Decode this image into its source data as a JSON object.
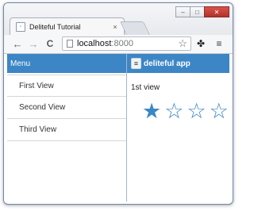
{
  "browser": {
    "tab_title": "Deliteful Tutorial",
    "tab_close": "×",
    "window_controls": {
      "minimize": "–",
      "maximize": "□",
      "close": "✕"
    },
    "nav": {
      "back": "←",
      "forward": "→",
      "reload": "C"
    },
    "url_host": "localhost",
    "url_port": ":8000",
    "bookmark_star": "☆",
    "extension_icon": "puzzle-icon",
    "menu_icon": "≡"
  },
  "menu": {
    "title": "Menu",
    "items": [
      {
        "label": "First View"
      },
      {
        "label": "Second View"
      },
      {
        "label": "Third View"
      }
    ]
  },
  "app": {
    "title": "deliteful app",
    "toggle_label": "≡",
    "view_label": "1st view",
    "rating": {
      "value": 1,
      "max": 4
    }
  },
  "colors": {
    "header": "#3c86c6",
    "star": "#3c86c6"
  }
}
